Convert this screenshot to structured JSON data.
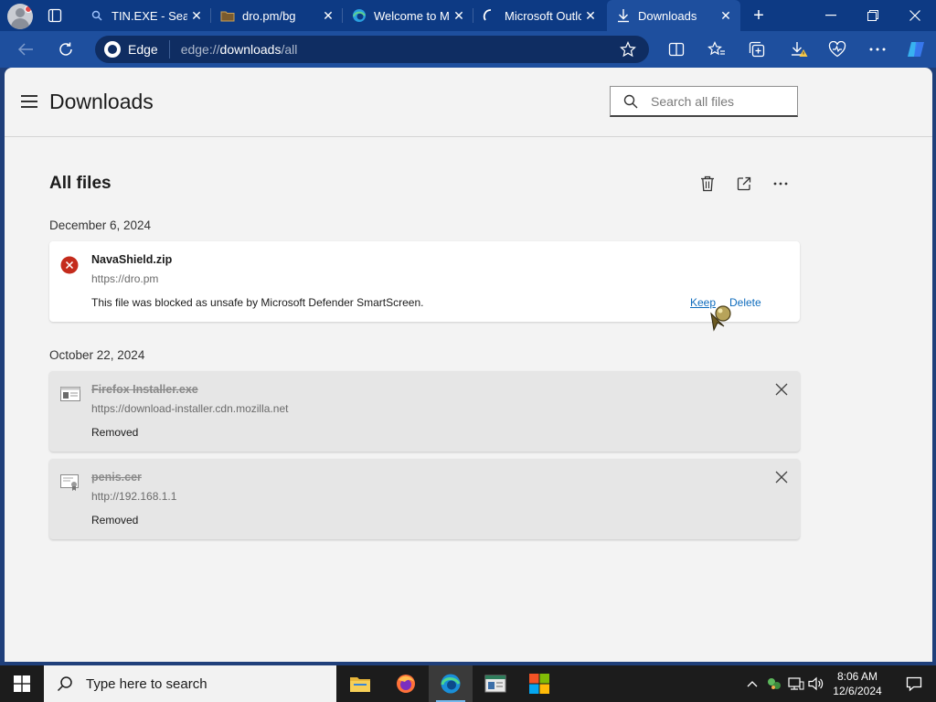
{
  "tabs": [
    {
      "title": "TIN.EXE - Search",
      "icon": "search-icon"
    },
    {
      "title": "dro.pm/bg",
      "icon": "folder-icon"
    },
    {
      "title": "Welcome to Microsoft Edge",
      "icon": "edge-icon"
    },
    {
      "title": "Microsoft Outlook",
      "icon": "loading-icon"
    },
    {
      "title": "Downloads",
      "icon": "download-icon",
      "active": true
    }
  ],
  "address": {
    "chip_label": "Edge",
    "url_scheme": "edge://",
    "url_host": "downloads",
    "url_path": "/all"
  },
  "page": {
    "title": "Downloads",
    "search_placeholder": "Search all files",
    "section_title": "All files"
  },
  "groups": [
    {
      "date": "December 6, 2024",
      "items": [
        {
          "name": "NavaShield.zip",
          "source": "https://dro.pm",
          "status": "This file was blocked as unsafe by Microsoft Defender SmartScreen.",
          "state": "blocked",
          "keep_label": "Keep",
          "delete_label": "Delete"
        }
      ]
    },
    {
      "date": "October 22, 2024",
      "items": [
        {
          "name": "Firefox Installer.exe",
          "source": "https://download-installer.cdn.mozilla.net",
          "status": "Removed",
          "state": "removed",
          "icon": "exe-file-icon"
        },
        {
          "name": "penis.cer",
          "source": "http://192.168.1.1",
          "status": "Removed",
          "state": "removed",
          "icon": "certificate-file-icon"
        }
      ]
    }
  ],
  "taskbar": {
    "search_placeholder": "Type here to search",
    "time": "8:06 AM",
    "date": "12/6/2024"
  },
  "colors": {
    "tabbar": "#0d3a84",
    "toolbar": "#1e4f9e",
    "link": "#0f6cbd",
    "blocked": "#c42b1c"
  }
}
